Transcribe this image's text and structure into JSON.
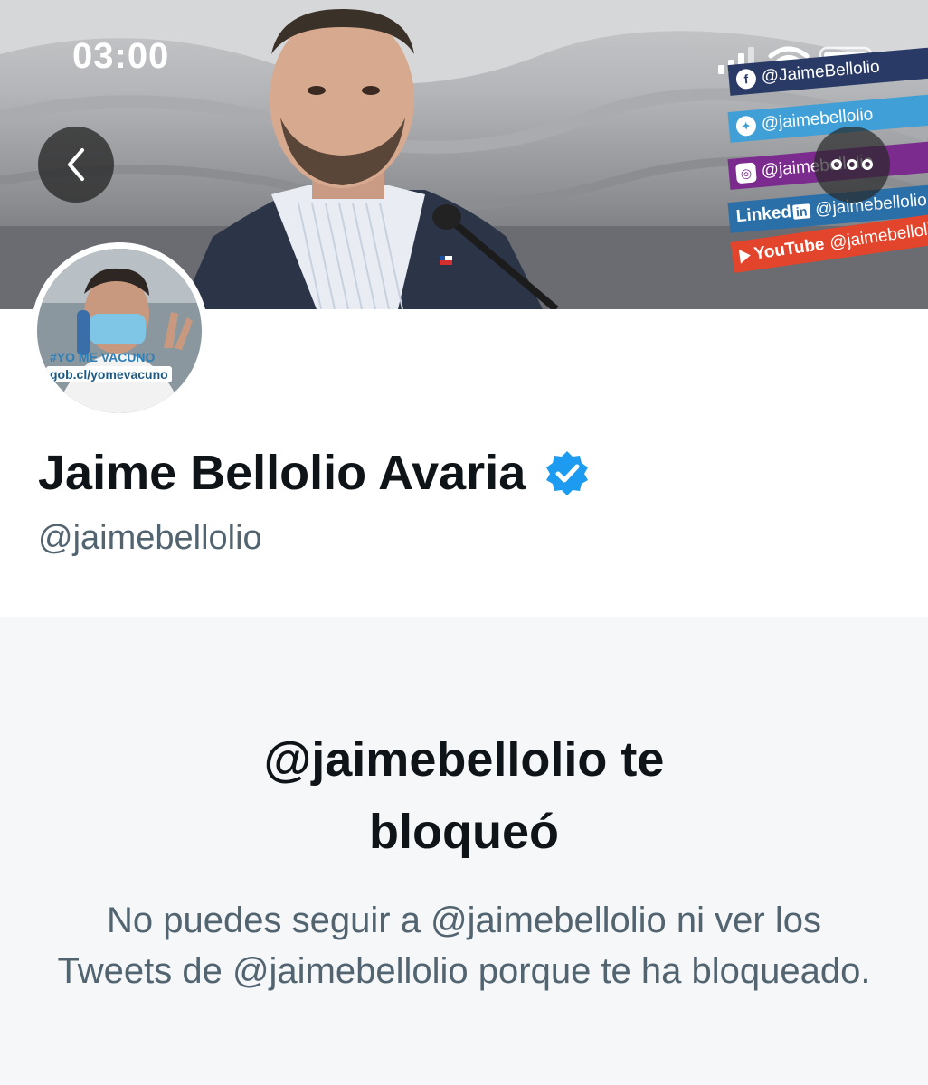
{
  "status_bar": {
    "time": "03:00",
    "icons": [
      "signal-icon",
      "wifi-icon",
      "battery-icon"
    ]
  },
  "banner": {
    "social_links": [
      {
        "network": "Facebook",
        "icon": "f",
        "label": "@JaimeBellolio",
        "color": "#2a3a66"
      },
      {
        "network": "Twitter",
        "icon": "twitter-icon",
        "label": "@jaimebellolio",
        "color": "#3f9fd6"
      },
      {
        "network": "Instagram",
        "icon": "instagram-icon",
        "label": "@jaimebellolio",
        "color": "#7b2a8e"
      },
      {
        "network": "LinkedIn",
        "icon": "Linked",
        "label": "@jaimebellolio",
        "color": "#2a6fa8"
      },
      {
        "network": "YouTube",
        "icon": "YouTube",
        "label": "@jaimebellolio",
        "color": "#e2452c"
      }
    ],
    "linkedin_badge": "in"
  },
  "avatar": {
    "hashtag": "#YO ME VACUNO",
    "tag": "gob.cl/yomevacuno"
  },
  "profile": {
    "display_name": "Jaime Bellolio Avaria",
    "handle": "@jaimebellolio",
    "verified": true,
    "verified_color": "#1d9bf0"
  },
  "blocked": {
    "title_line1": "@jaimebellolio te",
    "title_line2": "bloqueó",
    "description": "No puedes seguir a @jaimebellolio ni ver los Tweets de @jaimebellolio porque te ha bloqueado."
  }
}
